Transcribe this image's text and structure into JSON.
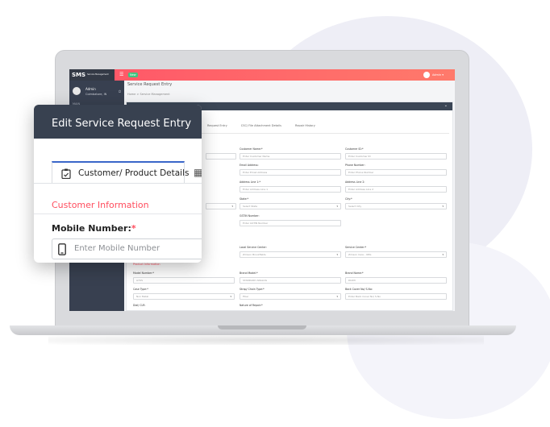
{
  "app": {
    "brand": "SMS",
    "brand_sub": "Service Management System",
    "new_badge": "New",
    "admin_label": "Admin ▾"
  },
  "sidebar": {
    "user_name": "Admin",
    "user_location": "Coimbatore, IN",
    "section_label": "MAIN"
  },
  "page": {
    "title": "Service Request Entry",
    "breadcrumb": "Home  >  Service Management"
  },
  "tabs": [
    "Request Entry",
    "CSC/ File Attachment Details",
    "Repair History"
  ],
  "form": {
    "row1": [
      {
        "label": "Customer Name:*",
        "placeholder": "Enter Customer Name"
      },
      {
        "label": "Customer ID:*",
        "placeholder": "Enter Customer ID"
      }
    ],
    "row2": [
      {
        "label": "Email Address:",
        "placeholder": "Enter Email Address"
      },
      {
        "label": "Phone Number:",
        "placeholder": "Enter Phone Number"
      }
    ],
    "row3": [
      {
        "label": "Address Line 1:*",
        "placeholder": "Enter Address Line 1"
      },
      {
        "label": "Address Line 2:",
        "placeholder": "Enter Address Line 2"
      }
    ],
    "row4": [
      {
        "label": "State:*",
        "placeholder": "Select State"
      },
      {
        "label": "City:*",
        "placeholder": "Select City"
      }
    ],
    "gstin": {
      "label": "GSTIN Number:",
      "placeholder": "Enter GSTIN Number"
    },
    "local_center": {
      "label": "Local Service Center:",
      "value": "Zimson Brookfields"
    },
    "service_center": {
      "label": "Service Center:*",
      "value": "Zimson Care - OPG"
    },
    "product_section": "Product Information",
    "model": {
      "label": "Model Number:*",
      "value": "A7US"
    },
    "brand_model": {
      "label": "Brand Model:*",
      "value": "STANDARD ANALOG"
    },
    "brand_name": {
      "label": "Brand Name:*",
      "value": "DIAMI"
    },
    "case_type": {
      "label": "Case Type:*",
      "value": "Non Metal"
    },
    "strap_type": {
      "label": "Strap/ Chain Type:*",
      "value": "Fiber"
    },
    "back_cover": {
      "label": "Back Cover No/ S.No:",
      "placeholder": "Enter Back Cover No/ S.No"
    },
    "dial": {
      "label": "Dial/ CLR:"
    },
    "nature": {
      "label": "Nature of Repair:*"
    }
  },
  "card": {
    "title": "Edit Service Request Entry",
    "tab_label": "Customer/ Product Details",
    "section": "Customer Information",
    "mobile_label": "Mobile Number:",
    "mobile_req": "*",
    "mobile_placeholder": "Enter Mobile Number"
  }
}
